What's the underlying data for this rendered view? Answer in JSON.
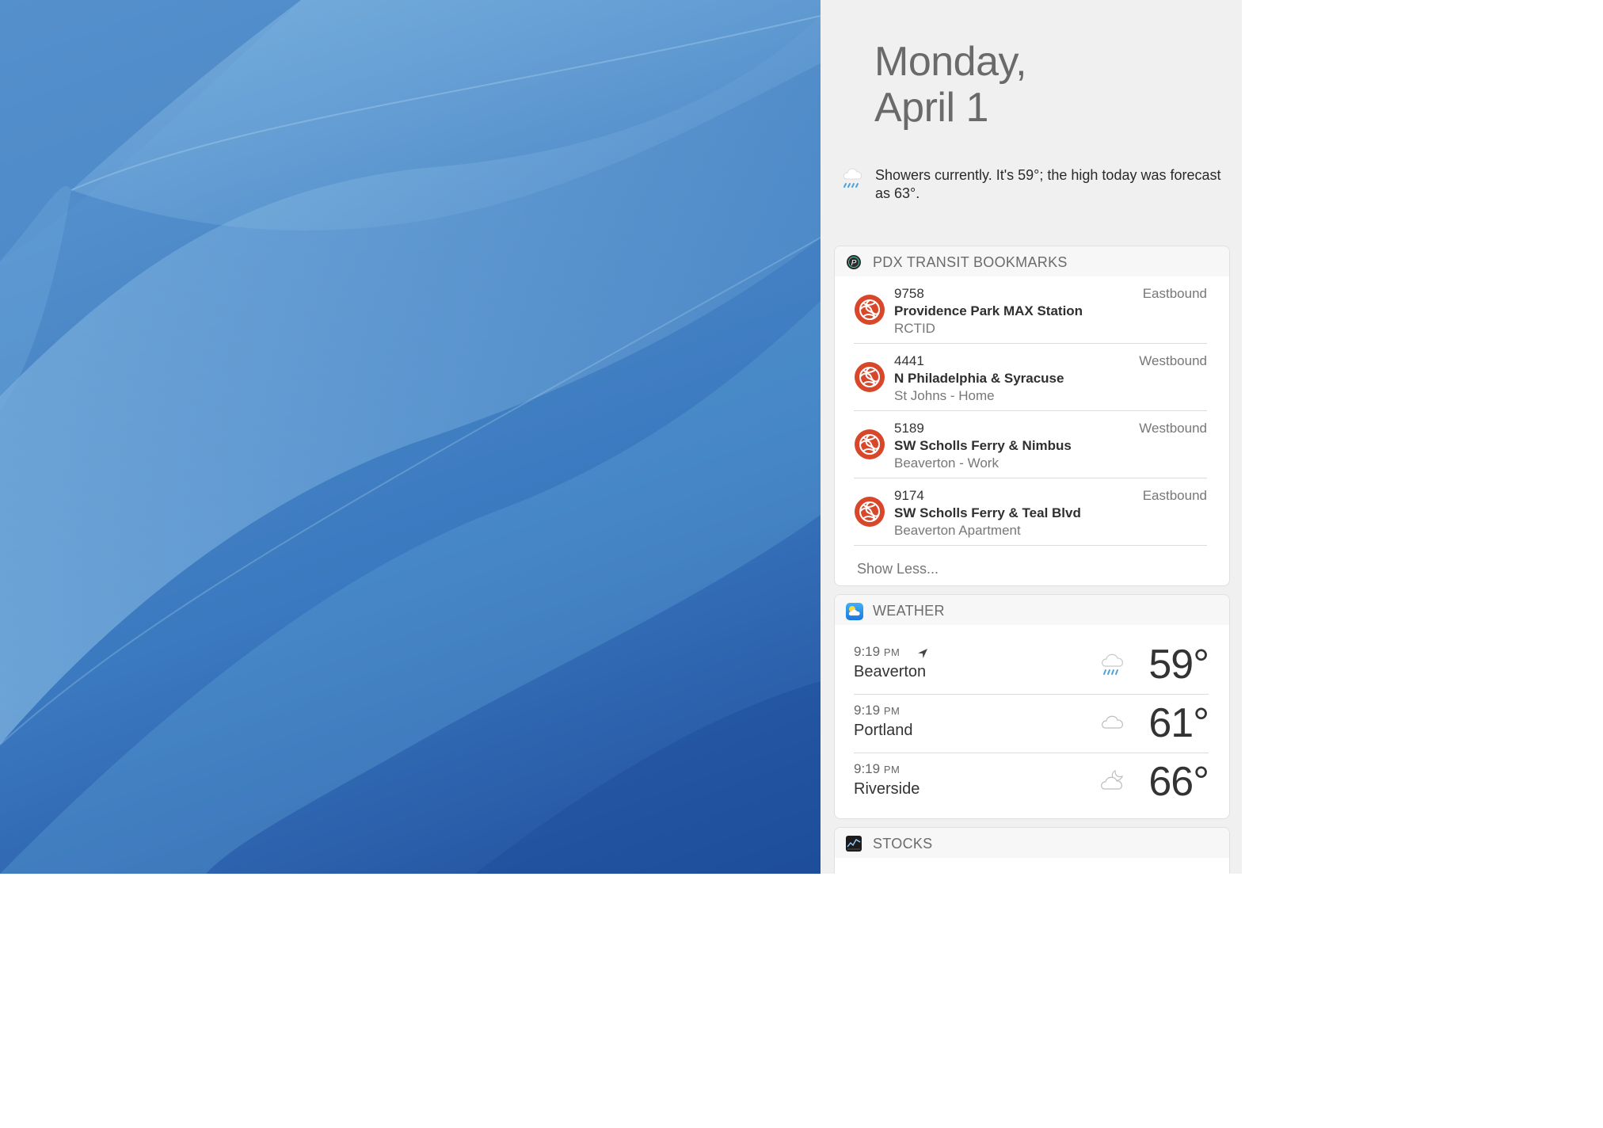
{
  "date": {
    "line1": "Monday,",
    "line2": "April 1"
  },
  "summary": {
    "icon": "rain-cloud-icon",
    "text": "Showers currently. It's 59°; the high today was forecast as 63°."
  },
  "transit": {
    "title": "PDX TRANSIT BOOKMARKS",
    "icon": "pdx-transit-app-icon",
    "stops": [
      {
        "id": "9758",
        "name": "Providence Park MAX Station",
        "sub": "RCTID",
        "direction": "Eastbound"
      },
      {
        "id": "4441",
        "name": "N Philadelphia & Syracuse",
        "sub": "St Johns - Home",
        "direction": "Westbound"
      },
      {
        "id": "5189",
        "name": "SW Scholls Ferry & Nimbus",
        "sub": "Beaverton - Work",
        "direction": "Westbound"
      },
      {
        "id": "9174",
        "name": "SW Scholls Ferry & Teal Blvd",
        "sub": "Beaverton Apartment",
        "direction": "Eastbound"
      }
    ],
    "show_less": "Show Less..."
  },
  "weather": {
    "title": "WEATHER",
    "icon": "weather-app-icon",
    "locations": [
      {
        "time": "9:19",
        "ampm": "PM",
        "city": "Beaverton",
        "temp": "59°",
        "condition": "rain-icon",
        "current_location": true
      },
      {
        "time": "9:19",
        "ampm": "PM",
        "city": "Portland",
        "temp": "61°",
        "condition": "cloud-icon",
        "current_location": false
      },
      {
        "time": "9:19",
        "ampm": "PM",
        "city": "Riverside",
        "temp": "66°",
        "condition": "partly-cloudy-night-icon",
        "current_location": false
      }
    ]
  },
  "stocks": {
    "title": "STOCKS",
    "icon": "stocks-app-icon"
  },
  "colors": {
    "panel_bg": "#f0f0f0",
    "transit_logo": "#d9472b",
    "rain_blue": "#4aa3df",
    "wallpaper_blue": "#3b79c0"
  }
}
